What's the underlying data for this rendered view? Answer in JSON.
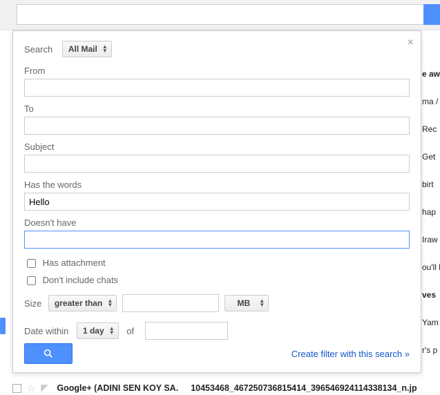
{
  "panel": {
    "search_label": "Search",
    "search_scope": "All Mail",
    "from_label": "From",
    "from_value": "",
    "to_label": "To",
    "to_value": "",
    "subject_label": "Subject",
    "subject_value": "",
    "haswords_label": "Has the words",
    "haswords_value": "Hello",
    "doesnthave_label": "Doesn't have",
    "doesnthave_value": "",
    "has_attachment_label": "Has attachment",
    "dont_include_chats_label": "Don't include chats",
    "size_label": "Size",
    "size_op": "greater than",
    "size_value": "",
    "size_unit": "MB",
    "date_label": "Date within",
    "date_range": "1 day",
    "date_of": "of",
    "date_value": "",
    "filter_link": "Create filter with this search »"
  },
  "bg": {
    "r1": "e aw",
    "r2": "ma /",
    "r3": "Rec",
    "r4": "Get",
    "r5": "birt",
    "r6": "hap",
    "r7": "Iraw",
    "r8": "ou'll l",
    "r9": "ves",
    "r10": "Yam",
    "r11": "r's p"
  },
  "listrow": {
    "sender": "Google+ (ADINI SEN KOY SA.",
    "subject": "10453468_467250736815414_396546924114338134_n.jp"
  }
}
